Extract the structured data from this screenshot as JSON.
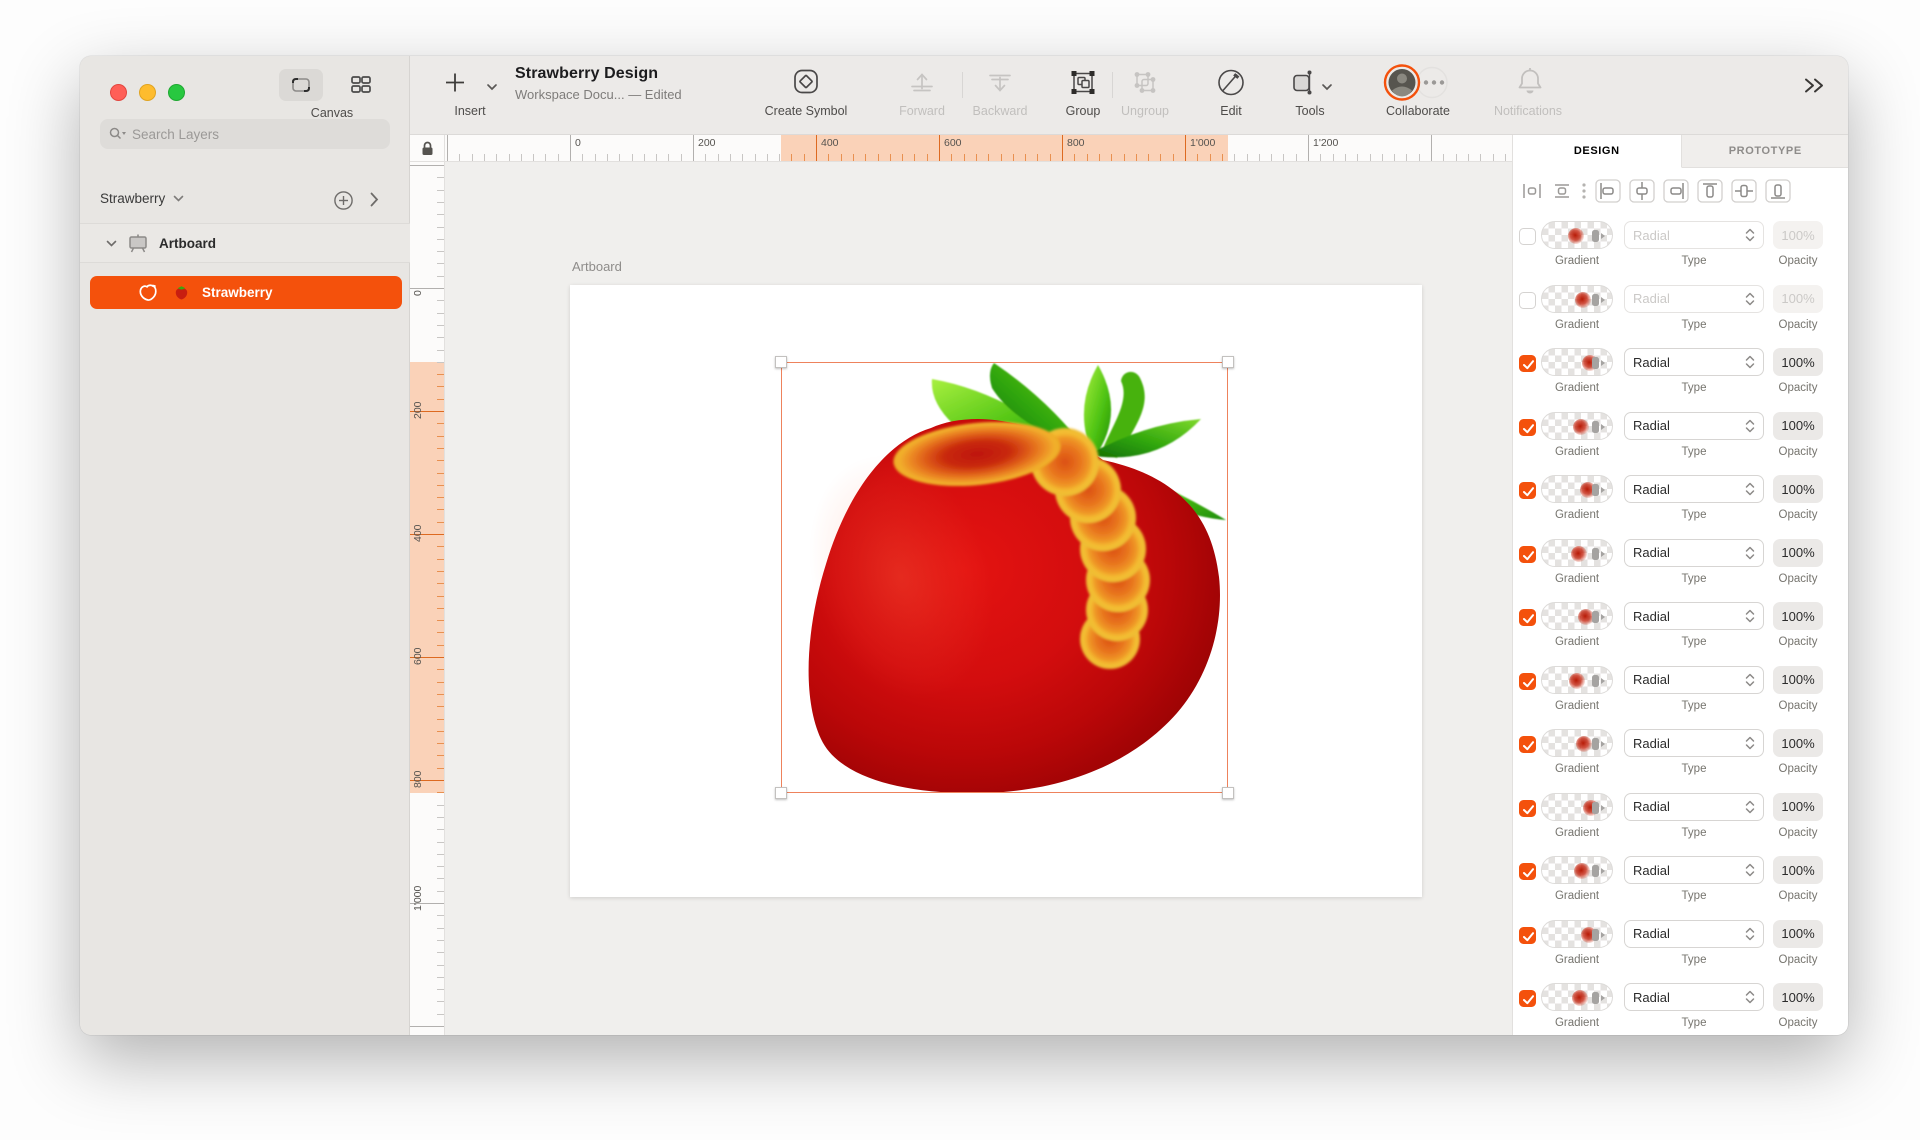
{
  "window": {
    "traffic_lights": [
      "close",
      "minimize",
      "zoom"
    ]
  },
  "sidebar": {
    "canvas_button_label": "Canvas",
    "search_placeholder": "Search Layers",
    "page_selector": "Strawberry",
    "artboard_item": "Artboard",
    "layer_item": "Strawberry"
  },
  "toolbar": {
    "insert_label": "Insert",
    "document_title": "Strawberry Design",
    "document_subtitle": "Workspace Docu... — Edited",
    "create_symbol_label": "Create Symbol",
    "forward_label": "Forward",
    "backward_label": "Backward",
    "group_label": "Group",
    "ungroup_label": "Ungroup",
    "edit_label": "Edit",
    "tools_label": "Tools",
    "collaborate_label": "Collaborate",
    "notifications_label": "Notifications"
  },
  "rulers": {
    "horizontal_labels": [
      "0",
      "200",
      "400",
      "600",
      "800",
      "1'000",
      "1'200"
    ],
    "vertical_labels": [
      "0",
      "200",
      "400",
      "600",
      "800",
      "1'000"
    ]
  },
  "canvas": {
    "artboard_label": "Artboard",
    "selected_layer": "Strawberry"
  },
  "inspector": {
    "tabs": [
      {
        "label": "DESIGN",
        "active": true
      },
      {
        "label": "PROTOTYPE",
        "active": false
      }
    ],
    "field_labels": {
      "gradient": "Gradient",
      "type": "Type",
      "opacity": "Opacity"
    },
    "rows": [
      {
        "enabled": false,
        "type": "Radial",
        "opacity": "100%"
      },
      {
        "enabled": false,
        "type": "Radial",
        "opacity": "100%"
      },
      {
        "enabled": true,
        "type": "Radial",
        "opacity": "100%"
      },
      {
        "enabled": true,
        "type": "Radial",
        "opacity": "100%"
      },
      {
        "enabled": true,
        "type": "Radial",
        "opacity": "100%"
      },
      {
        "enabled": true,
        "type": "Radial",
        "opacity": "100%"
      },
      {
        "enabled": true,
        "type": "Radial",
        "opacity": "100%"
      },
      {
        "enabled": true,
        "type": "Radial",
        "opacity": "100%"
      },
      {
        "enabled": true,
        "type": "Radial",
        "opacity": "100%"
      },
      {
        "enabled": true,
        "type": "Radial",
        "opacity": "100%"
      },
      {
        "enabled": true,
        "type": "Radial",
        "opacity": "100%"
      },
      {
        "enabled": true,
        "type": "Radial",
        "opacity": "100%"
      },
      {
        "enabled": true,
        "type": "Radial",
        "opacity": "100%"
      }
    ]
  },
  "colors": {
    "accent": "#F4510C",
    "ruler_highlight": "#FAD2B8",
    "selection_border": "#EE825C"
  }
}
